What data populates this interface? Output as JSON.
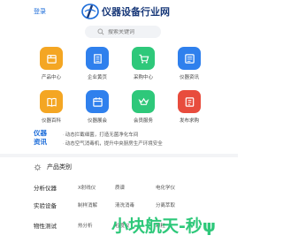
{
  "header": {
    "login_label": "登录",
    "site_name": "仪器设备行业网"
  },
  "search": {
    "placeholder": "搜索关键词"
  },
  "grid": {
    "row1": [
      {
        "label": "产品中心",
        "icon": "box-icon",
        "color": "#f4a623"
      },
      {
        "label": "企业黄页",
        "icon": "building-icon",
        "color": "#2f80ed"
      },
      {
        "label": "采购中心",
        "icon": "cart-icon",
        "color": "#2ec87a"
      },
      {
        "label": "仪器资讯",
        "icon": "news-icon",
        "color": "#2f80ed"
      }
    ],
    "row2": [
      {
        "label": "仪器百科",
        "icon": "book-icon",
        "color": "#f4a623"
      },
      {
        "label": "仪器展会",
        "icon": "calendar-icon",
        "color": "#2f80ed"
      },
      {
        "label": "会员服务",
        "icon": "vip-icon",
        "color": "#2ec87a"
      },
      {
        "label": "发布求购",
        "icon": "post-icon",
        "color": "#e84c3d"
      }
    ]
  },
  "news": {
    "badge_top": "仪器",
    "badge_bottom": "资讯",
    "items": [
      "动态拦截细菌，打造无菌净化车间",
      "动态空气消毒机，提升中央厨房生产环境安全"
    ]
  },
  "categories": {
    "title": "产品类别",
    "rows": [
      {
        "head": "分析仪器",
        "items": [
          "X射线仪",
          "质谱",
          "电化学仪"
        ]
      },
      {
        "head": "实验设备",
        "items": [
          "制样消解",
          "清洗消毒",
          "分离萃取"
        ]
      },
      {
        "head": "物性测试",
        "items": [
          "热分析",
          "粒度仪",
          "颗粒"
        ]
      }
    ]
  },
  "watermark": "小块航天-秒ψ",
  "colors": {
    "accent": "#1a6bd9",
    "brand_dark": "#1a3a7a",
    "watermark": "#2ec87a"
  }
}
